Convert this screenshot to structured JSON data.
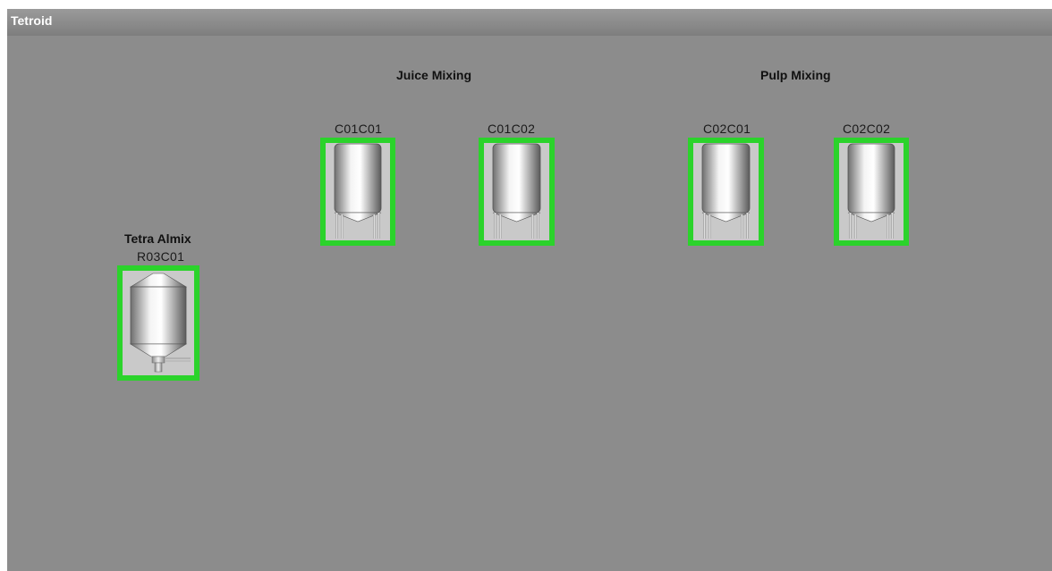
{
  "app": {
    "title": "Tetroid"
  },
  "groups": {
    "juice": "Juice Mixing",
    "pulp": "Pulp Mixing",
    "almix": "Tetra Almix"
  },
  "tanks": {
    "c01c01": {
      "id": "C01C01",
      "status_color": "#2bd32b"
    },
    "c01c02": {
      "id": "C01C02",
      "status_color": "#2bd32b"
    },
    "c02c01": {
      "id": "C02C01",
      "status_color": "#2bd32b"
    },
    "c02c02": {
      "id": "C02C02",
      "status_color": "#2bd32b"
    },
    "r03c01": {
      "id": "R03C01",
      "status_color": "#2bd32b"
    }
  },
  "colors": {
    "background": "#8c8c8c",
    "status_ok": "#2bd32b"
  }
}
